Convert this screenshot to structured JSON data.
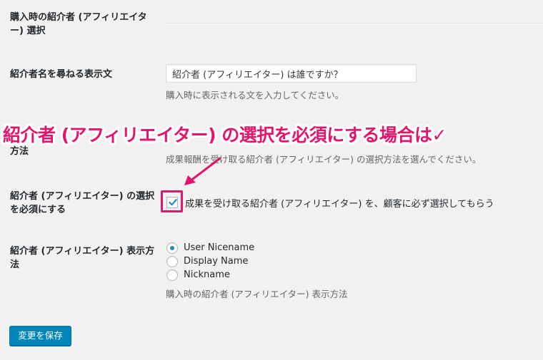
{
  "rows": {
    "affiliate_selection": {
      "label": "購入時の紹介者 (アフィリエイター) 選択"
    },
    "prompt_text": {
      "label": "紹介者名を尋ねる表示文",
      "input_value": "紹介者 (アフィリエイター) は誰ですか？",
      "description": "購入時に表示される文を入力してください。"
    },
    "selection_method": {
      "label_visible": "方法",
      "description": "成果報酬を受け取る紹介者 (アフィリエイター) の選択方法を選んでください。"
    },
    "required": {
      "label": "紹介者 (アフィリエイター) の選択を必須にする",
      "checkbox_checked": true,
      "checkbox_label": "成果を受け取る紹介者 (アフィリエイター) を、顧客に必ず選択してもらう"
    },
    "display_method": {
      "label": "紹介者 (アフィリエイター) 表示方法",
      "options": [
        {
          "label": "User Nicename",
          "selected": true
        },
        {
          "label": "Display Name",
          "selected": false
        },
        {
          "label": "Nickname",
          "selected": false
        }
      ],
      "description": "購入時の紹介者 (アフィリエイター) 表示方法"
    }
  },
  "save_button": {
    "label": "変更を保存"
  },
  "annotation": {
    "text": "紹介者 (アフィリエイター) の選択を必須にする場合は✓"
  },
  "colors": {
    "accent": "#e3156b",
    "primary_button": "#0085ba",
    "radio_dot": "#1e8cbe"
  }
}
